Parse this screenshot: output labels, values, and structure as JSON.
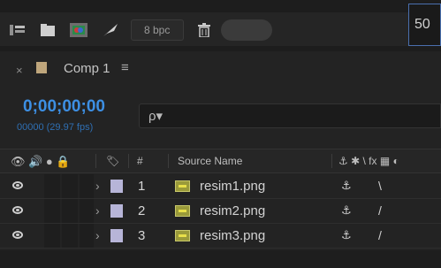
{
  "toolbar": {
    "icons": [
      "flowchart-icon",
      "folder-icon",
      "composition-icon",
      "feather-icon",
      "trash-icon"
    ],
    "bpc_label": "8 bpc",
    "zoom_value": "50"
  },
  "comp_tab": {
    "close_glyph": "×",
    "label": "Comp 1",
    "menu_glyph": "≡",
    "swatch_color": "#bfa67c"
  },
  "timeline": {
    "timecode": "0;00;00;00",
    "frame_readout": "00000 (29.97 fps)",
    "search_glyph": "ρ▾"
  },
  "columns": {
    "av_switches": "👁 🔊 ● 🔒",
    "label_col": "🏷",
    "number_col": "#",
    "source_name": "Source Name",
    "switches": "⚓ ✱ \\ fx ▦ ◐"
  },
  "layers": [
    {
      "number": "1",
      "name": "resim1.png",
      "shy": "⚓",
      "switch": "\\"
    },
    {
      "number": "2",
      "name": "resim2.png",
      "shy": "⚓",
      "switch": "/"
    },
    {
      "number": "3",
      "name": "resim3.png",
      "shy": "⚓",
      "switch": "/"
    }
  ],
  "colors": {
    "timecode": "#3d8fe3",
    "layer_label": "#b7b5d8",
    "zoom_border": "#4a6fae"
  }
}
